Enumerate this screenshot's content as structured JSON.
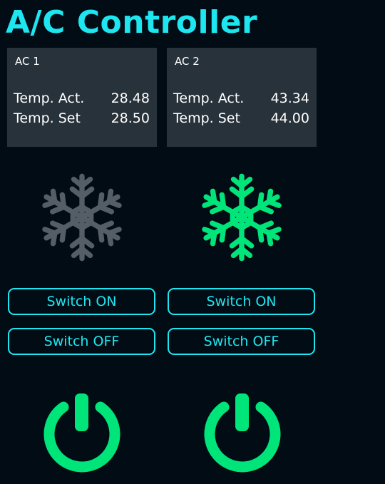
{
  "app": {
    "title": "A/C Controller"
  },
  "colors": {
    "accent": "#1ee6f0",
    "active": "#00e57a",
    "inactive": "#555e66",
    "panel": "#28323a",
    "background": "#020c14"
  },
  "units": [
    {
      "name": "AC 1",
      "temp_act_label": "Temp. Act.",
      "temp_act": "28.48",
      "temp_set_label": "Temp. Set",
      "temp_set": "28.50",
      "status_icon": "snowflake-icon",
      "cooling_active": false,
      "switch_on_label": "Switch ON",
      "switch_off_label": "Switch OFF",
      "power_icon": "power-icon"
    },
    {
      "name": "AC 2",
      "temp_act_label": "Temp. Act.",
      "temp_act": "43.34",
      "temp_set_label": "Temp. Set",
      "temp_set": "44.00",
      "status_icon": "snowflake-icon",
      "cooling_active": true,
      "switch_on_label": "Switch ON",
      "switch_off_label": "Switch OFF",
      "power_icon": "power-icon"
    }
  ]
}
